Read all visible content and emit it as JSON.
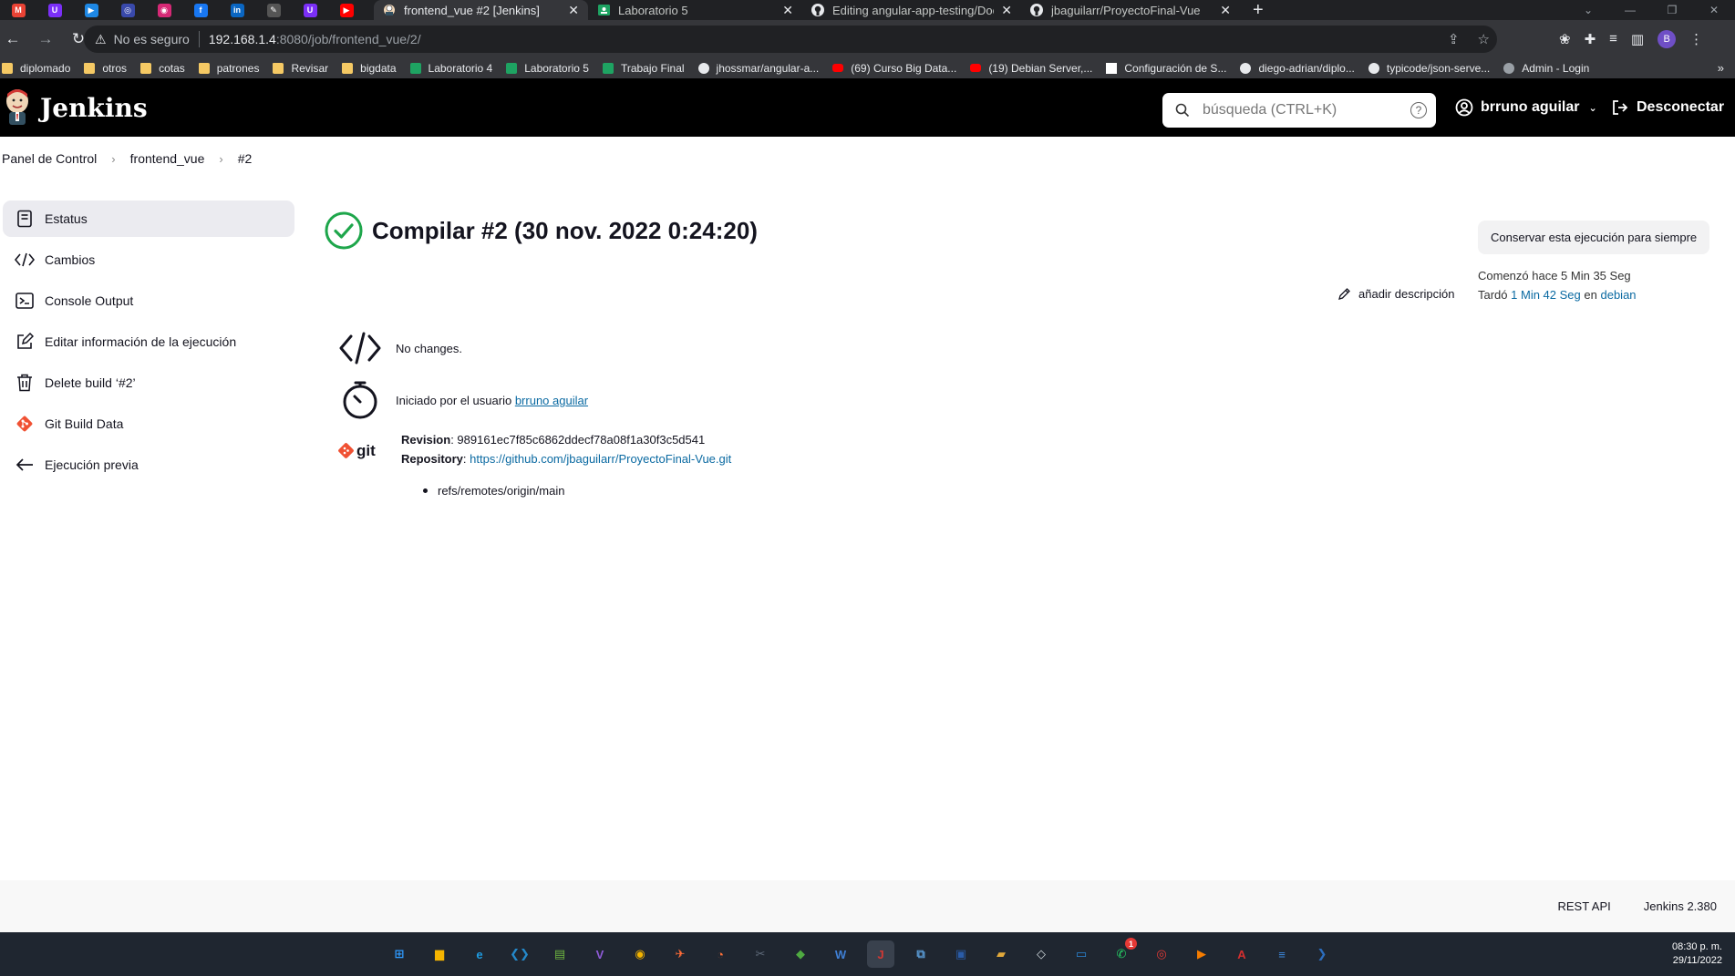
{
  "browser": {
    "pinned_tabs": [
      {
        "icon": "gmail-icon",
        "color": "#ea4335",
        "glyph": "M"
      },
      {
        "icon": "app-icon",
        "color": "#7b2ff7",
        "glyph": "U"
      },
      {
        "icon": "play-icon",
        "color": "#1e88e5",
        "glyph": "▶"
      },
      {
        "icon": "meet-icon",
        "color": "#3949ab",
        "glyph": "◎"
      },
      {
        "icon": "instagram-icon",
        "color": "#d62976",
        "glyph": "◉"
      },
      {
        "icon": "facebook-icon",
        "color": "#1877f2",
        "glyph": "f"
      },
      {
        "icon": "linkedin-icon",
        "color": "#0a66c2",
        "glyph": "in"
      },
      {
        "icon": "tool-icon",
        "color": "#555555",
        "glyph": "✎"
      },
      {
        "icon": "app-icon",
        "color": "#7b2ff7",
        "glyph": "U"
      },
      {
        "icon": "youtube-icon",
        "color": "#ff0000",
        "glyph": "▶"
      }
    ],
    "tabs": [
      {
        "title": "frontend_vue #2 [Jenkins]",
        "icon": "jenkins-icon",
        "active": true
      },
      {
        "title": "Laboratorio 5",
        "icon": "classroom-icon",
        "active": false
      },
      {
        "title": "Editing angular-app-testing/Doc",
        "icon": "github-icon",
        "active": false
      },
      {
        "title": "jbaguilarr/ProyectoFinal-Vue",
        "icon": "github-icon",
        "active": false
      }
    ],
    "new_tab": "+",
    "address": {
      "security": "No es seguro",
      "host": "192.168.1.4",
      "path": ":8080/job/frontend_vue/2/"
    },
    "bookmarks": [
      {
        "label": "diplomado",
        "type": "folder"
      },
      {
        "label": "otros",
        "type": "folder"
      },
      {
        "label": "cotas",
        "type": "folder"
      },
      {
        "label": "patrones",
        "type": "folder"
      },
      {
        "label": "Revisar",
        "type": "folder"
      },
      {
        "label": "bigdata",
        "type": "folder"
      },
      {
        "label": "Laboratorio 4",
        "type": "classroom"
      },
      {
        "label": "Laboratorio 5",
        "type": "classroom"
      },
      {
        "label": "Trabajo Final",
        "type": "classroom"
      },
      {
        "label": "jhossmar/angular-a...",
        "type": "github"
      },
      {
        "label": "(69) Curso Big Data...",
        "type": "youtube"
      },
      {
        "label": "(19) Debian Server,...",
        "type": "youtube"
      },
      {
        "label": "Configuración de S...",
        "type": "page"
      },
      {
        "label": "diego-adrian/diplo...",
        "type": "github"
      },
      {
        "label": "typicode/json-serve...",
        "type": "github"
      },
      {
        "label": "Admin - Login",
        "type": "globe"
      }
    ],
    "bookmarks_more": "»",
    "profile_initial": "B"
  },
  "jenkins": {
    "brand": "Jenkins",
    "search_placeholder": "búsqueda (CTRL+K)",
    "help": "?",
    "user": "brruno aguilar",
    "logout": "Desconectar"
  },
  "breadcrumb": [
    "Panel de Control",
    "frontend_vue",
    "#2"
  ],
  "sidebar": [
    {
      "label": "Estatus",
      "icon": "status-icon",
      "active": true
    },
    {
      "label": "Cambios",
      "icon": "code-icon",
      "active": false
    },
    {
      "label": "Console Output",
      "icon": "terminal-icon",
      "active": false
    },
    {
      "label": "Editar información de la ejecución",
      "icon": "edit-icon",
      "active": false
    },
    {
      "label": "Delete build ‘#2’",
      "icon": "trash-icon",
      "active": false
    },
    {
      "label": "Git Build Data",
      "icon": "git-icon",
      "active": false
    },
    {
      "label": "Ejecución previa",
      "icon": "arrow-left-icon",
      "active": false
    }
  ],
  "build": {
    "title": "Compilar #2 (30 nov. 2022 0:24:20)",
    "status": "success",
    "keep_button": "Conservar esta ejecución para siempre",
    "started": "Comenzó hace 5 Min 35 Seg",
    "took_prefix": "Tardó",
    "duration": "1 Min 42 Seg",
    "took_mid": "en",
    "node": "debian",
    "add_description": "añadir descripción",
    "changes": "No changes.",
    "started_by_prefix": "Iniciado por el usuario",
    "started_by_user": "brruno aguilar",
    "git_label": "git",
    "revision_label": "Revision",
    "revision": "989161ec7f85c6862ddecf78a08f1a30f3c5d541",
    "repository_label": "Repository",
    "repository": "https://github.com/jbaguilarr/ProyectoFinal-Vue.git",
    "ref": "refs/remotes/origin/main"
  },
  "footer": {
    "rest_api": "REST API",
    "version": "Jenkins 2.380"
  },
  "taskbar": {
    "apps": [
      {
        "icon": "windows-start-icon",
        "color": "#2f9bff",
        "glyph": "⊞"
      },
      {
        "icon": "file-explorer-icon",
        "color": "#f5b400",
        "glyph": "▆"
      },
      {
        "icon": "edge-icon",
        "color": "#1e9be0",
        "glyph": "e"
      },
      {
        "icon": "vscode-icon",
        "color": "#2489ca",
        "glyph": "❮❯"
      },
      {
        "icon": "notepad-icon",
        "color": "#6db33f",
        "glyph": "▤"
      },
      {
        "icon": "visual-studio-icon",
        "color": "#8f5bd8",
        "glyph": "V"
      },
      {
        "icon": "chrome-icon",
        "color": "#f4b400",
        "glyph": "◉"
      },
      {
        "icon": "postman-icon",
        "color": "#ff6c37",
        "glyph": "✈"
      },
      {
        "icon": "firefox-icon",
        "color": "#ff7139",
        "glyph": "◔"
      },
      {
        "icon": "snipping-tool-icon",
        "color": "#5f6b7a",
        "glyph": "✂"
      },
      {
        "icon": "mongodb-icon",
        "color": "#4faa41",
        "glyph": "◆"
      },
      {
        "icon": "writer-icon",
        "color": "#3f7fd4",
        "glyph": "W"
      },
      {
        "icon": "jenkins-taskbar-icon",
        "color": "#d33833",
        "glyph": "J"
      },
      {
        "icon": "network-icon",
        "color": "#5a9bd5",
        "glyph": "⧉"
      },
      {
        "icon": "virtualbox-icon",
        "color": "#2a5ca8",
        "glyph": "▣"
      },
      {
        "icon": "folder-app-icon",
        "color": "#e2a93b",
        "glyph": "▰"
      },
      {
        "icon": "cube-icon",
        "color": "#cfd8dc",
        "glyph": "◇"
      },
      {
        "icon": "remote-desktop-icon",
        "color": "#2b88d8",
        "glyph": "▭"
      },
      {
        "icon": "whatsapp-icon",
        "color": "#25d366",
        "glyph": "✆"
      },
      {
        "icon": "app-red-icon",
        "color": "#e53935",
        "glyph": "◎"
      },
      {
        "icon": "media-player-icon",
        "color": "#f57c00",
        "glyph": "▶"
      },
      {
        "icon": "acrobat-icon",
        "color": "#d32f2f",
        "glyph": "A"
      },
      {
        "icon": "notes-icon",
        "color": "#3d8be0",
        "glyph": "≡"
      },
      {
        "icon": "powershell-icon",
        "color": "#2c6ebf",
        "glyph": "❯"
      }
    ],
    "whatsapp_badge": "1",
    "time": "08:30 p. m.",
    "date": "29/11/2022"
  }
}
